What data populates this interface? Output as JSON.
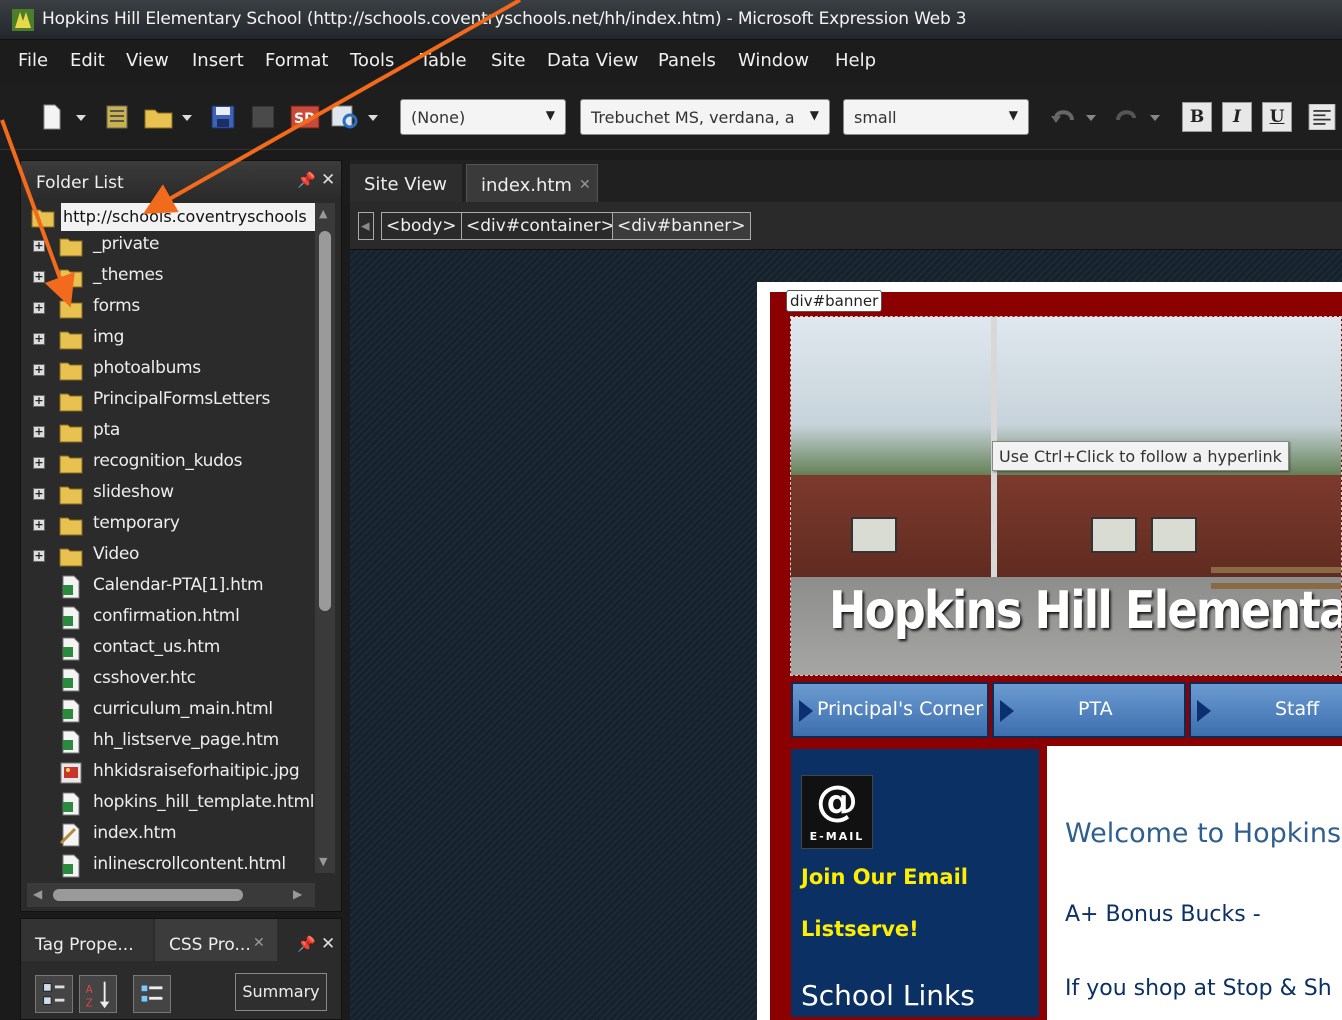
{
  "window": {
    "title": "Hopkins Hill Elementary School (http://schools.coventryschools.net/hh/index.htm) - Microsoft Expression Web 3"
  },
  "menu": [
    "File",
    "Edit",
    "View",
    "Insert",
    "Format",
    "Tools",
    "Table",
    "Site",
    "Data View",
    "Panels",
    "Window",
    "Help"
  ],
  "toolbar": {
    "style_value": "(None)",
    "font_value": "Trebuchet MS, verdana, a",
    "size_value": "small",
    "bold": "B",
    "italic": "I",
    "underline": "U"
  },
  "folder_list": {
    "title": "Folder List",
    "root_url": "http://schools.coventryschools",
    "folders": [
      "_private",
      "_themes",
      "forms",
      "img",
      "photoalbums",
      "PrincipalFormsLetters",
      "pta",
      "recognition_kudos",
      "slideshow",
      "temporary",
      "Video"
    ],
    "files": [
      "Calendar-PTA[1].htm",
      "confirmation.html",
      "contact_us.htm",
      "csshover.htc",
      "curriculum_main.html",
      "hh_listserve_page.htm",
      "hhkidsraiseforhaitipic.jpg",
      "hopkins_hill_template.html",
      "index.htm",
      "inlinescrollcontent.html"
    ]
  },
  "props_panel": {
    "tab1": "Tag Prope...",
    "tab2": "CSS Pro...",
    "summary": "Summary"
  },
  "doc_tabs": {
    "site_view": "Site View",
    "index": "index.htm"
  },
  "breadcrumb": [
    "<body>",
    "<div#container>",
    "<div#banner>"
  ],
  "design": {
    "banner_tag": "div#banner",
    "banner_title": "Hopkins Hill Elementary",
    "tooltip": "Use Ctrl+Click to follow a hyperlink",
    "nav": [
      "Principal's Corner",
      "PTA",
      "Staff"
    ],
    "email_caption": "E-MAIL",
    "join_line1": "Join Our Email",
    "join_line2": "Listserve!",
    "school_links": "School Links",
    "welcome": "Welcome to Hopkins",
    "bonus": "A+ Bonus Bucks -",
    "shop": "If you shop at Stop & Sh"
  },
  "colors": {
    "accent_arrow": "#f26a1b",
    "banner_border": "#8b0000",
    "sidebar_bg": "#0b3164",
    "link_yellow": "#ffee00"
  }
}
